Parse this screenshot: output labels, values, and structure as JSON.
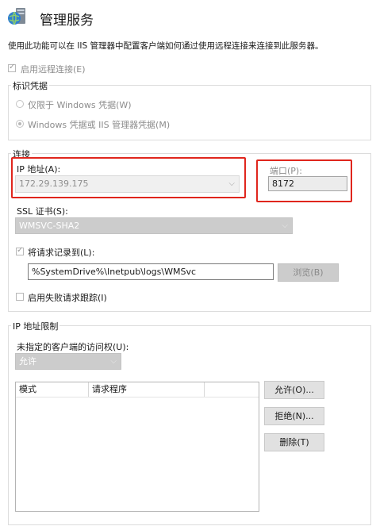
{
  "header": {
    "title": "管理服务",
    "description": "使用此功能可以在 IIS 管理器中配置客户端如何通过使用远程连接来连接到此服务器。"
  },
  "enable_remote": {
    "label": "启用远程连接(E)",
    "checked": true
  },
  "credentials": {
    "legend": "标识凭据",
    "option_windows": "仅限于 Windows 凭据(W)",
    "option_both": "Windows 凭据或 IIS 管理器凭据(M)",
    "selected": "option_both"
  },
  "connection": {
    "legend": "连接",
    "ip_label": "IP 地址(A):",
    "ip_value": "172.29.139.175",
    "port_label": "端口(P):",
    "port_value": "8172",
    "ssl_label": "SSL 证书(S):",
    "ssl_value": "WMSVC-SHA2",
    "log_label": "将请求记录到(L):",
    "log_checked": true,
    "log_path": "%SystemDrive%\\Inetpub\\logs\\WMSvc",
    "browse_button": "浏览(B)",
    "failed_trace_label": "启用失败请求跟踪(I)",
    "failed_trace_checked": false
  },
  "ip_restrictions": {
    "legend": "IP 地址限制",
    "access_label": "未指定的客户端的访问权(U):",
    "access_value": "允许",
    "table_headers": [
      "模式",
      "请求程序"
    ],
    "allow_button": "允许(O)...",
    "deny_button": "拒绝(N)...",
    "remove_button": "删除(T)"
  },
  "icons": {
    "header_icon": "server-globe-icon",
    "dropdown": "chevron-down-icon"
  },
  "colors": {
    "highlight_border": "#e0261d"
  }
}
